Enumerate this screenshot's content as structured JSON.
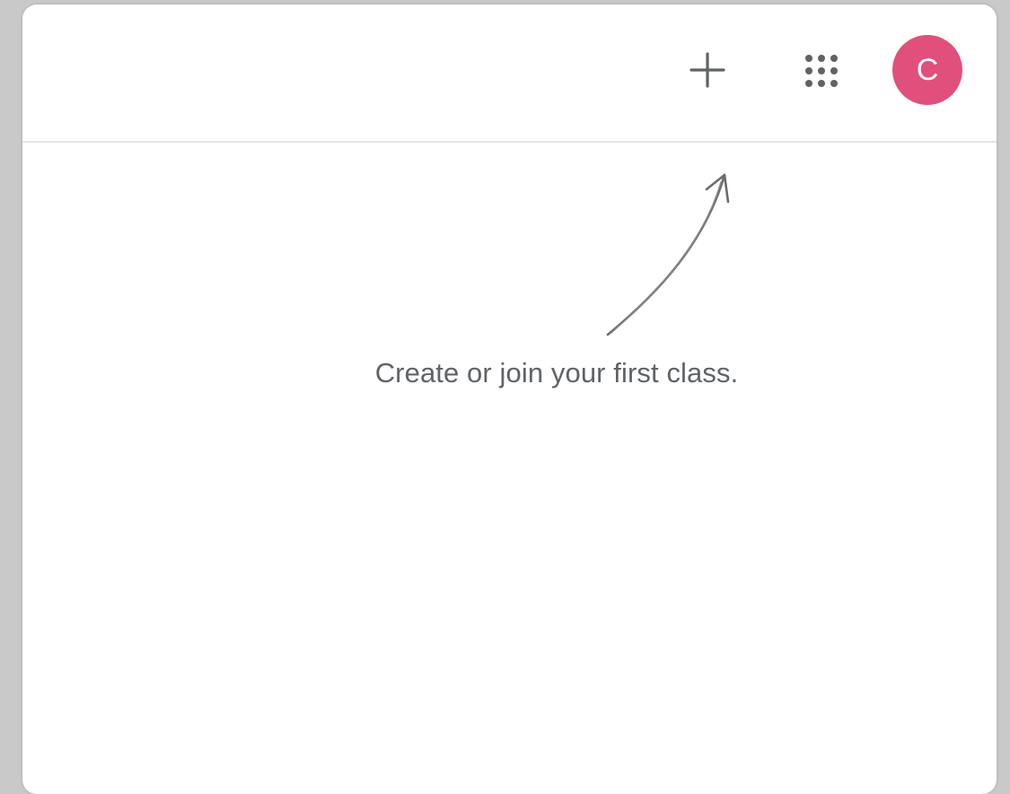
{
  "app": {
    "colors": {
      "avatar_bg": "#e0507a",
      "icon": "#5f6368",
      "divider": "#e3e3e3"
    }
  },
  "header": {
    "add_icon": "plus-icon",
    "apps_icon": "apps-grid-icon",
    "avatar_initial": "C"
  },
  "main": {
    "empty_state_message": "Create or join your first class.",
    "hint_icon": "hand-drawn-arrow-icon"
  }
}
